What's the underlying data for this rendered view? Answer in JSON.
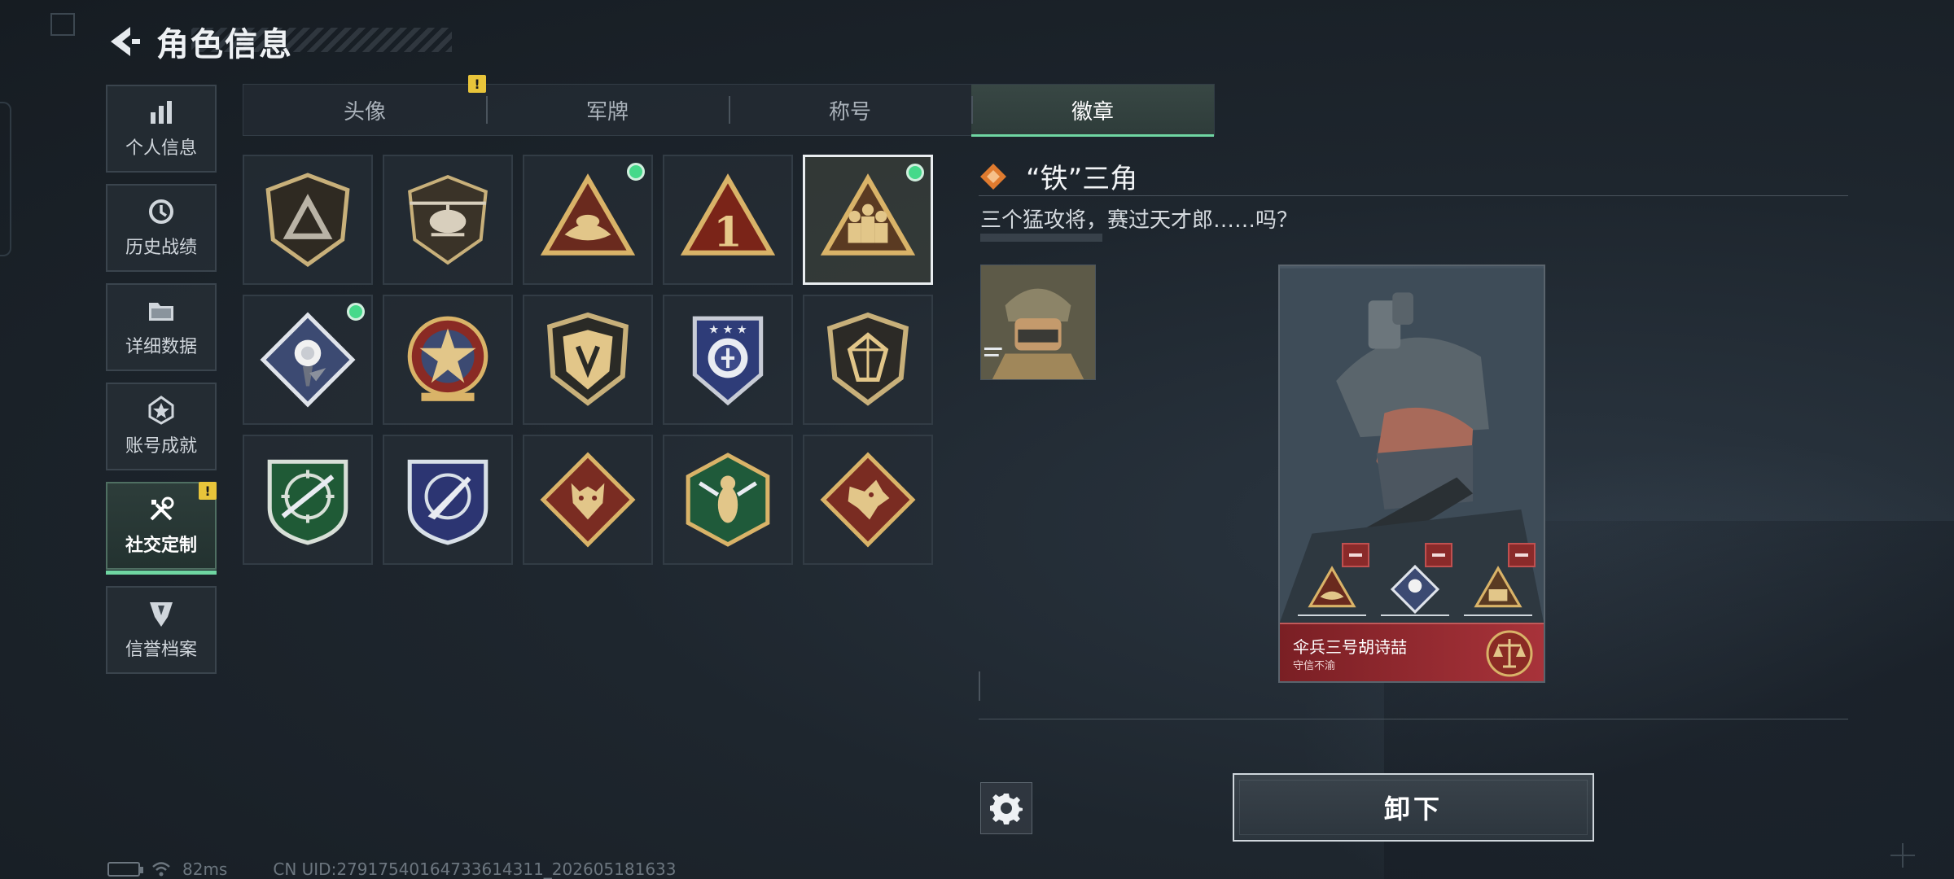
{
  "header": {
    "title": "角色信息"
  },
  "sidebar": {
    "items": [
      {
        "label": "个人信息",
        "icon": "bar-chart-icon",
        "active": false
      },
      {
        "label": "历史战绩",
        "icon": "history-clock-icon",
        "active": false
      },
      {
        "label": "详细数据",
        "icon": "folder-icon",
        "active": false
      },
      {
        "label": "账号成就",
        "icon": "achievement-star-icon",
        "active": false
      },
      {
        "label": "社交定制",
        "icon": "tools-icon",
        "active": true,
        "warning": "!"
      },
      {
        "label": "信誉档案",
        "icon": "reputation-badge-icon",
        "active": false
      }
    ]
  },
  "tabs": [
    {
      "label": "头像",
      "warning": "!"
    },
    {
      "label": "军牌"
    },
    {
      "label": "称号"
    },
    {
      "label": "徽章",
      "active": true
    }
  ],
  "badges": [
    {
      "icon": "shield-triangle-badge-icon",
      "equipped": false,
      "selected": false
    },
    {
      "icon": "helicopter-badge-icon",
      "equipped": false,
      "selected": false
    },
    {
      "icon": "triangle-nest-badge-icon",
      "equipped": true,
      "selected": false
    },
    {
      "icon": "triangle-number-one-badge-icon",
      "equipped": false,
      "selected": false
    },
    {
      "icon": "triangle-squad-badge-icon",
      "equipped": true,
      "selected": true
    },
    {
      "icon": "rose-diamond-badge-icon",
      "equipped": true,
      "selected": false
    },
    {
      "icon": "star-medal-badge-icon",
      "equipped": false,
      "selected": false
    },
    {
      "icon": "gold-shield-emblem-badge-icon",
      "equipped": false,
      "selected": false
    },
    {
      "icon": "blue-stars-shield-badge-icon",
      "equipped": false,
      "selected": false
    },
    {
      "icon": "gem-shield-badge-icon",
      "equipped": false,
      "selected": false
    },
    {
      "icon": "green-rifle-crosshair-badge-icon",
      "equipped": false,
      "selected": false
    },
    {
      "icon": "blue-knife-crosshair-badge-icon",
      "equipped": false,
      "selected": false
    },
    {
      "icon": "wolf-diamond-badge-icon",
      "equipped": false,
      "selected": false
    },
    {
      "icon": "wasp-hexagon-badge-icon",
      "equipped": false,
      "selected": false
    },
    {
      "icon": "dragon-diamond-badge-icon",
      "equipped": false,
      "selected": false
    }
  ],
  "detail": {
    "name": "“铁”三角",
    "description": "三个猛攻将，赛过天才郎……吗？"
  },
  "preview": {
    "player_name": "伞兵三号胡诗喆",
    "player_subtitle": "守信不渝"
  },
  "actions": {
    "unequip_label": "卸下"
  },
  "status": {
    "ping": "82ms",
    "uid": "CN UID:27917540164733614311_202605181633"
  },
  "colors": {
    "accent_green": "#6fd6a2",
    "equipped_dot": "#45d98a",
    "warning_yellow": "#e8c43a",
    "card_red": "#a8333a"
  }
}
